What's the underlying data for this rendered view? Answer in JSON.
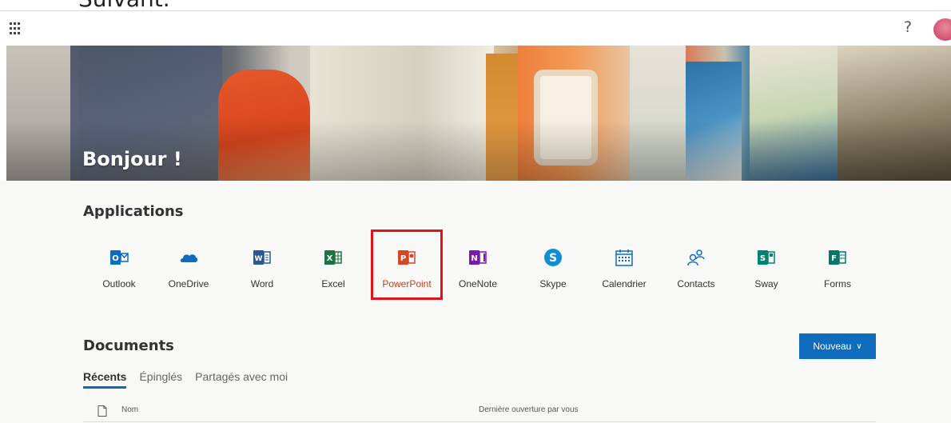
{
  "top_caption": "Suivant.",
  "header": {
    "help_symbol": "?",
    "icons": [
      "app-launcher-icon",
      "help-icon",
      "avatar"
    ]
  },
  "hero": {
    "greeting": "Bonjour !"
  },
  "applications": {
    "title": "Applications",
    "items": [
      {
        "label": "Outlook",
        "icon": "outlook-icon",
        "color": "#0f6cbd"
      },
      {
        "label": "OneDrive",
        "icon": "onedrive-icon",
        "color": "#0f6cbd"
      },
      {
        "label": "Word",
        "icon": "word-icon",
        "color": "#2b5797"
      },
      {
        "label": "Excel",
        "icon": "excel-icon",
        "color": "#1e7145"
      },
      {
        "label": "PowerPoint",
        "icon": "powerpoint-icon",
        "color": "#d24726"
      },
      {
        "label": "OneNote",
        "icon": "onenote-icon",
        "color": "#7719aa"
      },
      {
        "label": "Skype",
        "icon": "skype-icon",
        "color": "#0f8ed8"
      },
      {
        "label": "Calendrier",
        "icon": "calendar-icon",
        "color": "#0f6cbd"
      },
      {
        "label": "Contacts",
        "icon": "contacts-icon",
        "color": "#0f6cbd"
      },
      {
        "label": "Sway",
        "icon": "sway-icon",
        "color": "#008272"
      },
      {
        "label": "Forms",
        "icon": "forms-icon",
        "color": "#077568"
      }
    ],
    "selected": "PowerPoint",
    "highlight_color": "#e0131c"
  },
  "documents": {
    "title": "Documents",
    "new_button_label": "Nouveau",
    "new_button_chevron": "∨",
    "tabs": [
      "Récents",
      "Épinglés",
      "Partagés avec moi"
    ],
    "active_tab": "Récents",
    "columns": {
      "name": "Nom",
      "date": "Dernière ouverture par vous"
    }
  },
  "colors": {
    "accent": "#0f6cbd",
    "powerpoint": "#c43e1c"
  }
}
